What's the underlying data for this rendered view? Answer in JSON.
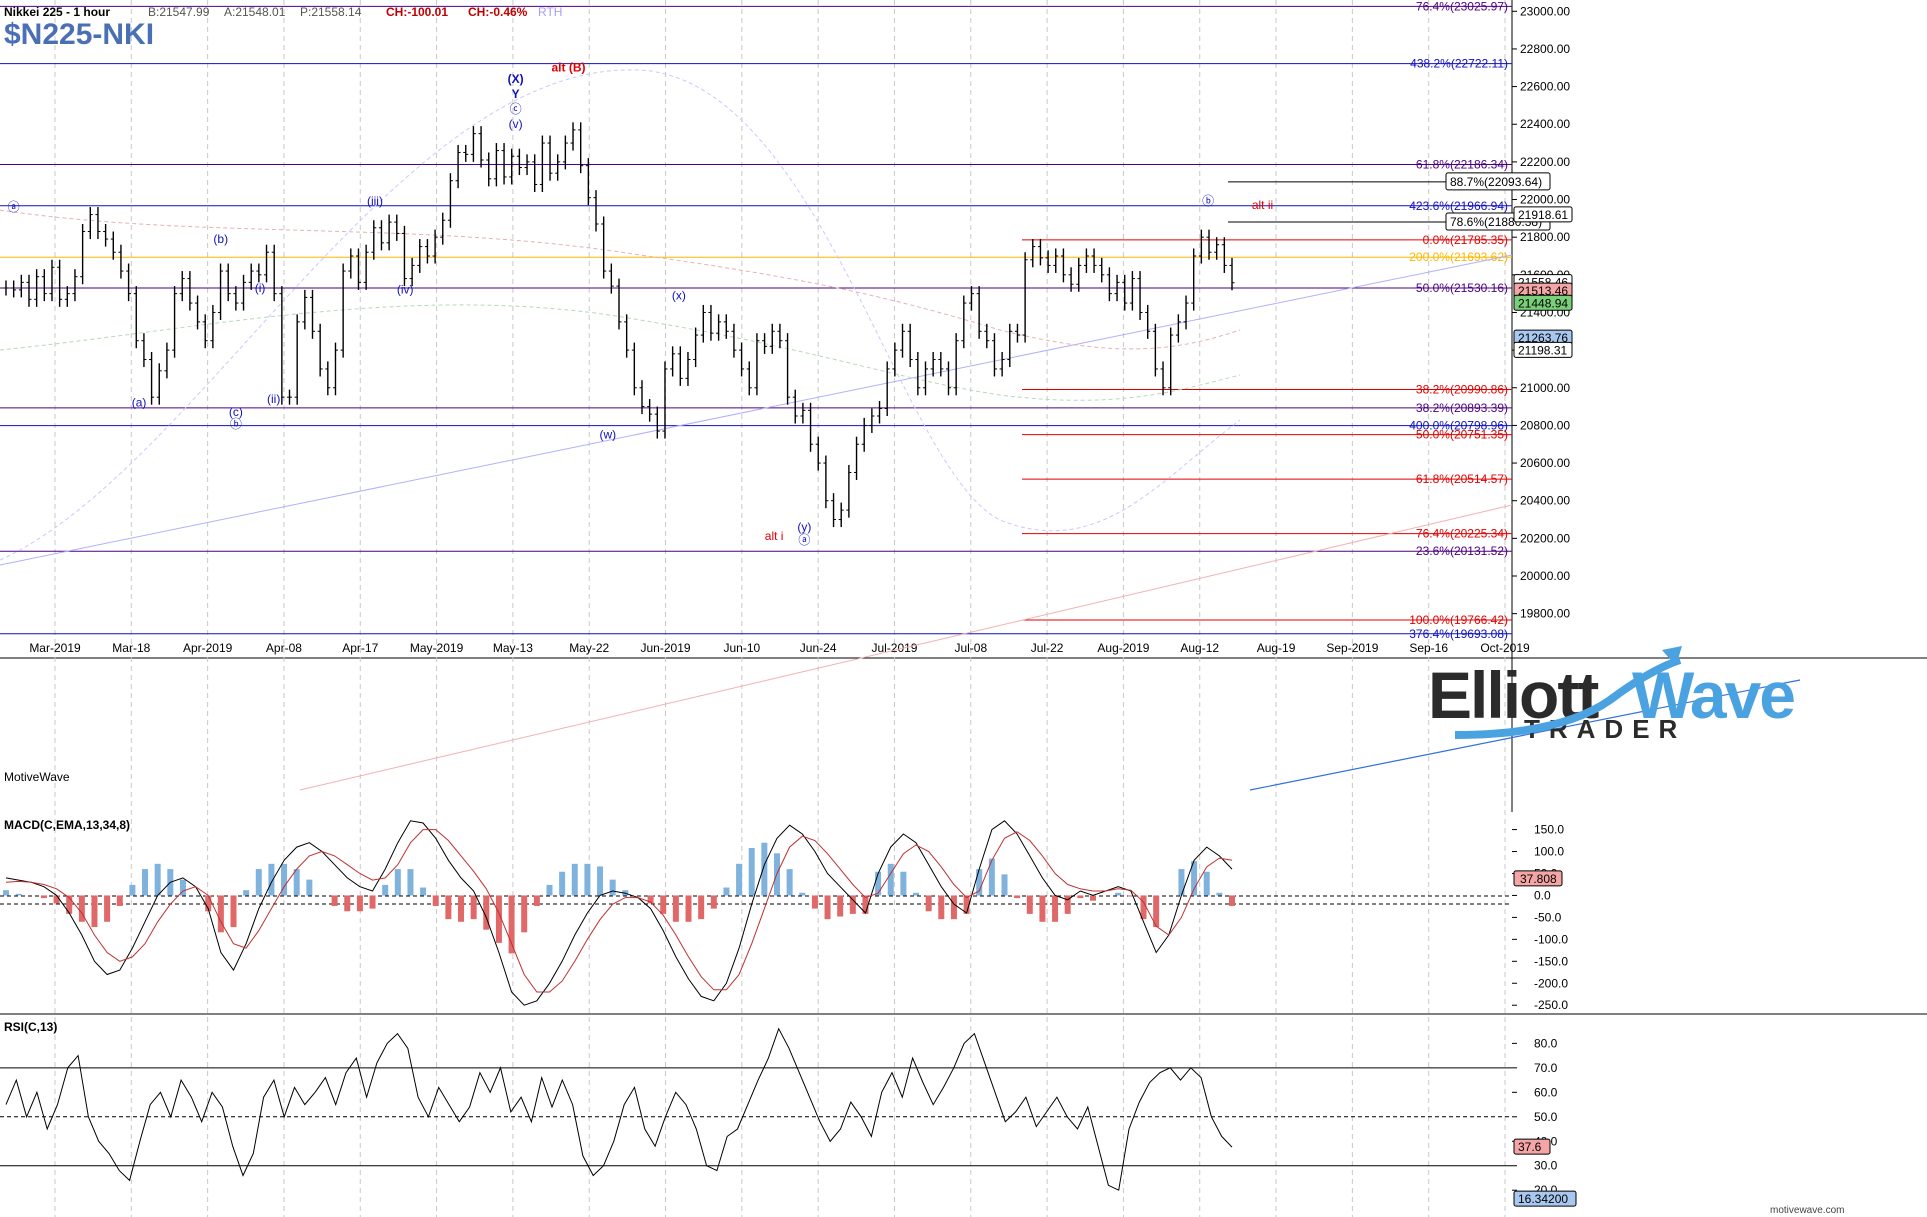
{
  "header": {
    "instrument": "Nikkei 225 - 1 hour",
    "quote_bid": "B:21547.99",
    "quote_ask": "A:21548.01",
    "quote_price": "P:21558.14",
    "quote_change": "CH:-100.01",
    "quote_change_pct": "CH:-0.46%",
    "session": "RTH",
    "symbol": "$N225-NKI"
  },
  "footer": {
    "provider_left": "MotiveWave",
    "provider_right": "motivewave.com"
  },
  "logo": {
    "word1": "Elliott",
    "word2": "Wave",
    "word3": "TRADER"
  },
  "colors": {
    "purple": "#4b0082",
    "blue": "#1010c0",
    "red": "#e00000",
    "orange": "#ffb800",
    "bars": "#000000"
  },
  "chart_data": [
    {
      "type": "line",
      "panel": "price",
      "title": "$N225-NKI",
      "ylim": [
        19660,
        23060
      ],
      "y_ticks": [
        23000,
        22800,
        22600,
        22400,
        22200,
        22000,
        21800,
        21600,
        21400,
        21200,
        21000,
        20800,
        20600,
        20400,
        20200,
        20000,
        19800
      ],
      "y_tick_labels": [
        "23000.00",
        "22800.00",
        "22600.00",
        "22400.00",
        "22200.00",
        "22000.00",
        "21800.00",
        "21600.00",
        "21400.00",
        "21200.00",
        "21000.00",
        "20800.00",
        "20600.00",
        "20400.00",
        "20200.00",
        "20000.00",
        "19800.00"
      ],
      "x_labels": [
        "Mar-2019",
        "Mar-18",
        "Apr-2019",
        "Apr-08",
        "Apr-17",
        "May-2019",
        "May-13",
        "May-22",
        "Jun-2019",
        "Jun-10",
        "Jun-24",
        "Jul-2019",
        "Jul-08",
        "Jul-22",
        "Aug-2019",
        "Aug-12",
        "Aug-19",
        "Sep-2019",
        "Sep-16",
        "Oct-2019"
      ],
      "series": [
        {
          "y": [
            21530,
            21520,
            21560,
            21470,
            21590,
            21500,
            21640,
            21470,
            21500,
            21590,
            21830,
            21920,
            21830,
            21790,
            21720,
            21620,
            21500,
            21250,
            21150,
            20950,
            21090,
            21200,
            21500,
            21580,
            21450,
            21350,
            21250,
            21400,
            21620,
            21500,
            21450,
            21560,
            21620,
            21600,
            21720,
            21500,
            20950,
            20950,
            21350,
            21480,
            21300,
            21100,
            21000,
            21200,
            21620,
            21700,
            21560,
            21720,
            21850,
            21770,
            21880,
            21820,
            21580,
            21650,
            21750,
            21700,
            21800,
            21890,
            22100,
            22250,
            22240,
            22350,
            22210,
            22110,
            22260,
            22120,
            22230,
            22170,
            22200,
            22080,
            22300,
            22140,
            22200,
            22300,
            22370,
            22180,
            22010,
            21870,
            21620,
            21540,
            21350,
            21200,
            21000,
            20900,
            20860,
            20770,
            21100,
            21180,
            21050,
            21150,
            21280,
            21400,
            21290,
            21350,
            21300,
            21200,
            21100,
            21000,
            21250,
            21220,
            21300,
            21250,
            20950,
            20850,
            20880,
            20700,
            20600,
            20400,
            20300,
            20350,
            20550,
            20700,
            20800,
            20850,
            20890,
            21100,
            21200,
            21300,
            21150,
            21000,
            21100,
            21150,
            21100,
            21000,
            21250,
            21450,
            21500,
            21300,
            21250,
            21100,
            21150,
            21300,
            21280,
            21680,
            21750,
            21690,
            21650,
            21700,
            21600,
            21550,
            21650,
            21700,
            21650,
            21600,
            21500,
            21560,
            21450,
            21580,
            21400,
            21300,
            21100,
            21000,
            21280,
            21350,
            21450,
            21700,
            21800,
            21720,
            21760,
            21650,
            21558
          ]
        }
      ],
      "levels": [
        {
          "label": "76.4%(23025.97)",
          "value": 23025.97,
          "color": "purple"
        },
        {
          "label": "438.2%(22722.11)",
          "value": 22722.11,
          "color": "blue"
        },
        {
          "label": "61.8%(22186.34)",
          "value": 22186.34,
          "color": "purple"
        },
        {
          "label": "88.7%(22093.64)",
          "value": 22093.64,
          "color": "black",
          "boxed": true
        },
        {
          "label": "423.6%(21966.94)",
          "value": 21966.94,
          "color": "blue"
        },
        {
          "label": "78.6%(21880.38)",
          "value": 21880.38,
          "color": "black",
          "boxed": true
        },
        {
          "label": "0.0%(21785.35)",
          "value": 21785.35,
          "color": "red"
        },
        {
          "label": "200.0%(21693.62)",
          "value": 21693.62,
          "color": "orange"
        },
        {
          "label": "50.0%(21530.16)",
          "value": 21530.16,
          "color": "purple"
        },
        {
          "label": "38.2%(20990.86)",
          "value": 20990.86,
          "color": "red"
        },
        {
          "label": "38.2%(20893.39)",
          "value": 20893.39,
          "color": "purple"
        },
        {
          "label": "400.0%(20798.96)",
          "value": 20798.96,
          "color": "blue"
        },
        {
          "label": "50.0%(20751.35)",
          "value": 20751.35,
          "color": "red"
        },
        {
          "label": "61.8%(20514.57)",
          "value": 20514.57,
          "color": "red"
        },
        {
          "label": "76.4%(20225.34)",
          "value": 20225.34,
          "color": "red"
        },
        {
          "label": "23.6%(20131.52)",
          "value": 20131.52,
          "color": "purple"
        },
        {
          "label": "100.0%(19766.42)",
          "value": 19766.42,
          "color": "red"
        },
        {
          "label": "376.4%(19693.08)",
          "value": 19693.08,
          "color": "blue"
        }
      ],
      "price_tags": [
        {
          "label": "21918.61",
          "value": 21918.61,
          "fill": "#ffffff"
        },
        {
          "label": "21558.46",
          "value": 21558.46,
          "fill": "#ffffff"
        },
        {
          "label": "21513.46",
          "value": 21513.46,
          "fill": "#f4a6a6"
        },
        {
          "label": "21448.94",
          "value": 21448.94,
          "fill": "#7ad07a"
        },
        {
          "label": "21263.76",
          "value": 21263.76,
          "fill": "#a9c8f0"
        },
        {
          "label": "21198.31",
          "value": 21198.31,
          "fill": "#ffffff"
        }
      ],
      "wave_labels": [
        {
          "text": "ⓐ",
          "x": 0.9,
          "y": 21940,
          "color": "blue"
        },
        {
          "text": "(b)",
          "x": 14.6,
          "y": 21770,
          "color": "blue"
        },
        {
          "text": "(a)",
          "x": 9.2,
          "y": 20900,
          "color": "blue"
        },
        {
          "text": "(c)",
          "x": 15.6,
          "y": 20850,
          "color": "blue"
        },
        {
          "text": "ⓑ",
          "x": 15.6,
          "y": 20785,
          "color": "blue"
        },
        {
          "text": "(i)",
          "x": 17.2,
          "y": 21510,
          "color": "blue"
        },
        {
          "text": "(ii)",
          "x": 18.1,
          "y": 20920,
          "color": "blue"
        },
        {
          "text": "(iii)",
          "x": 24.8,
          "y": 21970,
          "color": "blue"
        },
        {
          "text": "(iv)",
          "x": 26.8,
          "y": 21500,
          "color": "blue"
        },
        {
          "text": "(X)",
          "x": 34.1,
          "y": 22620,
          "color": "blue",
          "bold": true
        },
        {
          "text": "alt (B)",
          "x": 37.6,
          "y": 22680,
          "color": "red",
          "bold": true
        },
        {
          "text": "Y",
          "x": 34.1,
          "y": 22540,
          "color": "blue",
          "bold": true
        },
        {
          "text": "ⓒ",
          "x": 34.1,
          "y": 22460,
          "color": "blue"
        },
        {
          "text": "(v)",
          "x": 34.1,
          "y": 22380,
          "color": "blue"
        },
        {
          "text": "(x)",
          "x": 44.9,
          "y": 21470,
          "color": "blue"
        },
        {
          "text": "(w)",
          "x": 40.2,
          "y": 20730,
          "color": "blue"
        },
        {
          "text": "alt i",
          "x": 51.2,
          "y": 20190,
          "color": "red"
        },
        {
          "text": "(y)",
          "x": 53.2,
          "y": 20240,
          "color": "blue"
        },
        {
          "text": "ⓐ",
          "x": 53.2,
          "y": 20170,
          "color": "blue"
        },
        {
          "text": "ⓑ",
          "x": 79.9,
          "y": 21970,
          "color": "blue"
        },
        {
          "text": "alt ii",
          "x": 83.5,
          "y": 21950,
          "color": "red"
        }
      ]
    },
    {
      "type": "line",
      "panel": "macd",
      "title": "MACD(C,EMA,13,34,8)",
      "ylim": [
        -270,
        190
      ],
      "y_ticks": [
        150,
        100,
        50,
        0,
        -50,
        -100,
        -150,
        -200,
        -250
      ],
      "y_tick_labels": [
        "150.0",
        "100.0",
        "50.0",
        "0.0",
        "-50.0",
        "-100.0",
        "-150.0",
        "-200.0",
        "-250.0"
      ],
      "tag": {
        "label": "37.808",
        "value": 37.808
      },
      "series": [
        {
          "name": "macd",
          "y": [
            40,
            35,
            30,
            20,
            0,
            -40,
            -90,
            -150,
            -180,
            -170,
            -120,
            -60,
            0,
            30,
            40,
            20,
            -30,
            -130,
            -170,
            -110,
            -30,
            30,
            80,
            110,
            120,
            100,
            70,
            40,
            20,
            10,
            60,
            120,
            170,
            165,
            130,
            80,
            40,
            10,
            -50,
            -130,
            -220,
            -250,
            -240,
            -200,
            -150,
            -90,
            -40,
            0,
            10,
            5,
            -5,
            -30,
            -80,
            -140,
            -190,
            -230,
            -240,
            -200,
            -120,
            -20,
            70,
            130,
            160,
            140,
            100,
            50,
            20,
            -10,
            -40,
            50,
            110,
            140,
            120,
            70,
            20,
            -20,
            -40,
            60,
            150,
            170,
            140,
            90,
            40,
            0,
            -10,
            10,
            0,
            10,
            20,
            10,
            -60,
            -130,
            -90,
            0,
            80,
            110,
            90,
            60
          ]
        },
        {
          "name": "signal",
          "y": [
            30,
            32,
            30,
            25,
            15,
            -5,
            -40,
            -90,
            -130,
            -150,
            -140,
            -110,
            -60,
            -20,
            10,
            20,
            0,
            -60,
            -110,
            -120,
            -80,
            -30,
            20,
            60,
            90,
            100,
            90,
            70,
            50,
            35,
            40,
            70,
            120,
            150,
            150,
            125,
            90,
            55,
            15,
            -40,
            -110,
            -180,
            -220,
            -220,
            -195,
            -150,
            -100,
            -55,
            -20,
            -5,
            -5,
            -15,
            -45,
            -90,
            -140,
            -185,
            -215,
            -215,
            -180,
            -110,
            -30,
            50,
            110,
            135,
            125,
            95,
            60,
            25,
            -5,
            5,
            50,
            95,
            115,
            100,
            65,
            25,
            -5,
            10,
            80,
            130,
            145,
            125,
            90,
            50,
            25,
            15,
            10,
            10,
            15,
            12,
            -15,
            -70,
            -90,
            -50,
            15,
            65,
            85,
            80
          ]
        }
      ]
    },
    {
      "type": "line",
      "panel": "rsi",
      "title": "RSI(C,13)",
      "ylim": [
        16,
        92
      ],
      "y_ticks": [
        80,
        70,
        60,
        50,
        40,
        30,
        20
      ],
      "y_tick_labels": [
        "80.0",
        "70.0",
        "60.0",
        "50.0",
        "40.0",
        "30.0",
        "20.0"
      ],
      "tags": [
        {
          "label": "37.6",
          "value": 37.6
        },
        {
          "label": "16.34200",
          "value": 16.342
        }
      ],
      "overbought": 70,
      "oversold": 30,
      "series": [
        {
          "name": "rsi",
          "y": [
            55,
            65,
            50,
            60,
            45,
            55,
            70,
            75,
            50,
            40,
            35,
            28,
            24,
            40,
            55,
            60,
            50,
            65,
            58,
            48,
            60,
            54,
            38,
            26,
            35,
            58,
            65,
            50,
            62,
            55,
            60,
            66,
            55,
            68,
            74,
            58,
            72,
            80,
            84,
            78,
            58,
            50,
            62,
            55,
            48,
            54,
            68,
            60,
            70,
            52,
            58,
            48,
            66,
            54,
            65,
            55,
            34,
            26,
            30,
            40,
            55,
            62,
            45,
            38,
            50,
            60,
            55,
            45,
            30,
            28,
            42,
            45,
            55,
            65,
            74,
            86,
            78,
            68,
            58,
            48,
            40,
            45,
            56,
            50,
            42,
            60,
            68,
            58,
            74,
            64,
            55,
            62,
            70,
            80,
            84,
            72,
            60,
            48,
            52,
            58,
            46,
            52,
            58,
            50,
            45,
            54,
            38,
            22,
            20,
            45,
            56,
            64,
            68,
            70,
            65,
            70,
            66,
            50,
            42,
            37.6
          ]
        }
      ]
    }
  ]
}
